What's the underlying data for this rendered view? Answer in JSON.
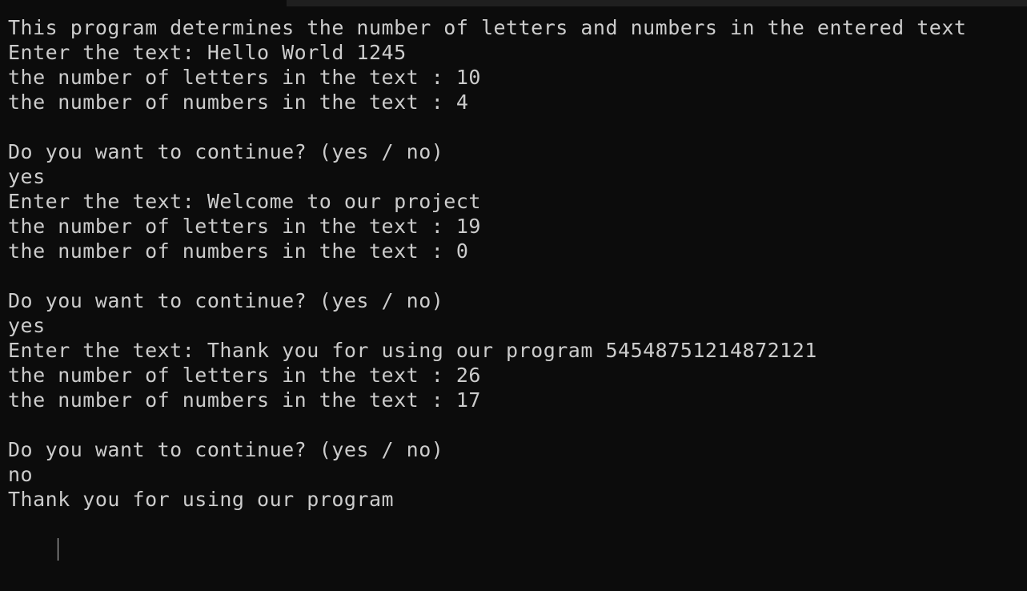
{
  "terminal": {
    "lines": [
      "This program determines the number of letters and numbers in the entered text",
      "Enter the text: Hello World 1245",
      "the number of letters in the text : 10",
      "the number of numbers in the text : 4",
      "",
      "Do you want to continue? (yes / no)",
      "yes",
      "Enter the text: Welcome to our project",
      "the number of letters in the text : 19",
      "the number of numbers in the text : 0",
      "",
      "Do you want to continue? (yes / no)",
      "yes",
      "Enter the text: Thank you for using our program 54548751214872121",
      "the number of letters in the text : 26",
      "the number of numbers in the text : 17",
      "",
      "Do you want to continue? (yes / no)",
      "no",
      "Thank you for using our program"
    ]
  },
  "colors": {
    "background": "#0c0c0c",
    "foreground": "#cccccc",
    "tabstrip": "#1f1f1f"
  }
}
